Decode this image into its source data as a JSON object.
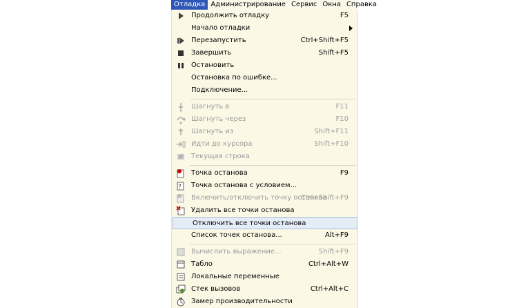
{
  "menubar": {
    "items": [
      "Отладка",
      "Администрирование",
      "Сервис",
      "Окна",
      "Справка"
    ]
  },
  "menu": {
    "items": [
      {
        "label": "Продолжить отладку",
        "shortcut": "F5",
        "icon": "continue-icon"
      },
      {
        "label": "Начало отладки",
        "shortcut": "",
        "icon": ""
      },
      {
        "label": "Перезапустить",
        "shortcut": "Ctrl+Shift+F5",
        "icon": "restart-icon"
      },
      {
        "label": "Завершить",
        "shortcut": "Shift+F5",
        "icon": "stop-icon"
      },
      {
        "label": "Остановить",
        "shortcut": "",
        "icon": "pause-icon"
      },
      {
        "label": "Остановка по ошибке...",
        "shortcut": "",
        "icon": ""
      },
      {
        "label": "Подключение...",
        "shortcut": "",
        "icon": ""
      },
      {
        "label": "Шагнуть в",
        "shortcut": "F11",
        "icon": "step-into-icon"
      },
      {
        "label": "Шагнуть через",
        "shortcut": "F10",
        "icon": "step-over-icon"
      },
      {
        "label": "Шагнуть из",
        "shortcut": "Shift+F11",
        "icon": "step-out-icon"
      },
      {
        "label": "Идти до курсора",
        "shortcut": "Shift+F10",
        "icon": "run-to-cursor-icon"
      },
      {
        "label": "Текущая строка",
        "shortcut": "",
        "icon": "current-line-icon"
      },
      {
        "label": "Точка останова",
        "shortcut": "F9",
        "icon": "breakpoint-icon"
      },
      {
        "label": "Точка останова с условием...",
        "shortcut": "",
        "icon": "conditional-breakpoint-icon"
      },
      {
        "label": "Включить/отключить точку останова",
        "shortcut": "Ctrl+Shift+F9",
        "icon": "toggle-breakpoint-icon"
      },
      {
        "label": "Удалить все точки останова",
        "shortcut": "",
        "icon": "delete-breakpoints-icon"
      },
      {
        "label": "Отключить все точки останова",
        "shortcut": "",
        "icon": ""
      },
      {
        "label": "Список точек останова...",
        "shortcut": "Alt+F9",
        "icon": ""
      },
      {
        "label": "Вычислить выражение...",
        "shortcut": "Shift+F9",
        "icon": "evaluate-icon"
      },
      {
        "label": "Табло",
        "shortcut": "Ctrl+Alt+W",
        "icon": "watch-icon"
      },
      {
        "label": "Локальные переменные",
        "shortcut": "",
        "icon": "locals-icon"
      },
      {
        "label": "Стек вызовов",
        "shortcut": "Ctrl+Alt+C",
        "icon": "call-stack-icon"
      },
      {
        "label": "Замер производительности",
        "shortcut": "",
        "icon": "performance-icon"
      }
    ]
  }
}
